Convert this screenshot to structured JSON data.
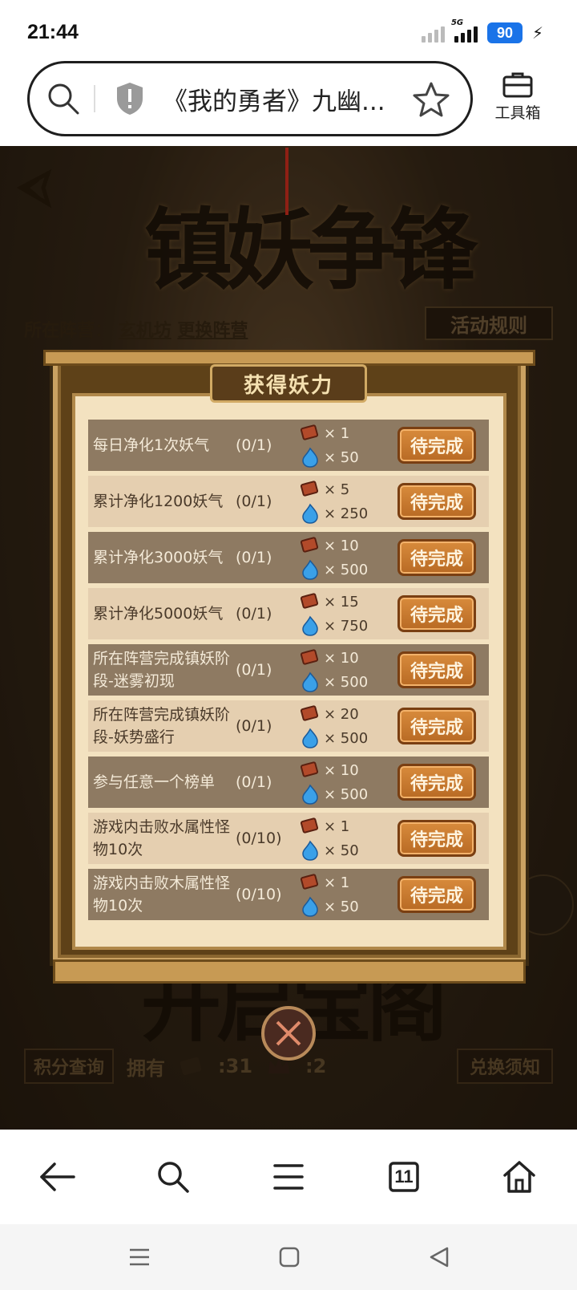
{
  "status": {
    "time": "21:44",
    "network": "5G",
    "battery": "90"
  },
  "browser": {
    "url_title": "《我的勇者》九幽...",
    "toolbox_label": "工具箱"
  },
  "game": {
    "title": "镇妖争锋",
    "camp_prefix": "所在阵营：",
    "camp_name": "玄机坊",
    "camp_change": "更换阵营",
    "rules_button": "活动规则",
    "bottom_title": "开启宝阁",
    "score_query": "积分查询",
    "own_label": "拥有",
    "own_token": ":31",
    "own_crown": ":2",
    "exchange_notice": "兑换须知"
  },
  "modal": {
    "title": "获得妖力",
    "button_label": "待完成",
    "tasks": [
      {
        "name": "每日净化1次妖气",
        "progress": "(0/1)",
        "reward_token": "× 1",
        "reward_spirit": "× 50"
      },
      {
        "name": "累计净化1200妖气",
        "progress": "(0/1)",
        "reward_token": "× 5",
        "reward_spirit": "× 250"
      },
      {
        "name": "累计净化3000妖气",
        "progress": "(0/1)",
        "reward_token": "× 10",
        "reward_spirit": "× 500"
      },
      {
        "name": "累计净化5000妖气",
        "progress": "(0/1)",
        "reward_token": "× 15",
        "reward_spirit": "× 750"
      },
      {
        "name": "所在阵营完成镇妖阶段-迷雾初现",
        "progress": "(0/1)",
        "reward_token": "× 10",
        "reward_spirit": "× 500"
      },
      {
        "name": "所在阵营完成镇妖阶段-妖势盛行",
        "progress": "(0/1)",
        "reward_token": "× 20",
        "reward_spirit": "× 500"
      },
      {
        "name": "参与任意一个榜单",
        "progress": "(0/1)",
        "reward_token": "× 10",
        "reward_spirit": "× 500"
      },
      {
        "name": "游戏内击败水属性怪物10次",
        "progress": "(0/10)",
        "reward_token": "× 1",
        "reward_spirit": "× 50"
      },
      {
        "name": "游戏内击败木属性怪物10次",
        "progress": "(0/10)",
        "reward_token": "× 1",
        "reward_spirit": "× 50"
      }
    ]
  },
  "nav": {
    "tab_count": "11"
  },
  "icons": [
    "search-icon",
    "shield-icon",
    "star-icon",
    "toolbox-icon",
    "back-icon",
    "close-icon",
    "token-icon",
    "spirit-flame-icon",
    "arrow-left-icon",
    "menu-icon",
    "tabs-icon",
    "home-icon"
  ],
  "colors": {
    "accent": "#1a73e8",
    "button_orange": "#c97a30",
    "row_dark": "#8e7a62",
    "row_light": "#e5cfb0"
  }
}
